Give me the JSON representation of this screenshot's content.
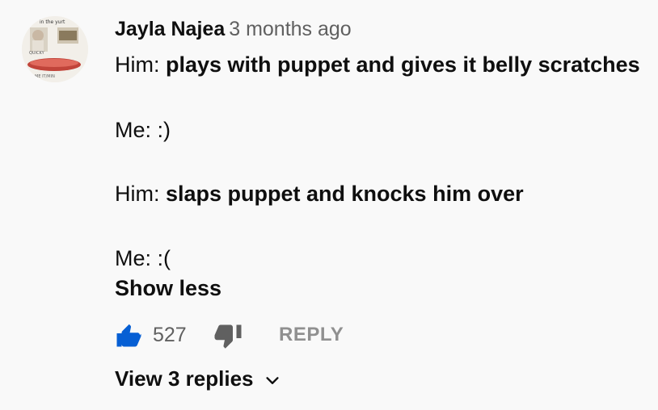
{
  "comment": {
    "author": "Jayla Najea",
    "timestamp": "3 months ago",
    "avatar": {
      "icon": "user-avatar-image",
      "top_text": "in the yurt",
      "sign_text": "QUICKY",
      "bottom_text": "ME IT/MIN"
    },
    "body": [
      {
        "prefix": "Him: ",
        "bold": "plays with puppet and gives it belly scratches"
      },
      {
        "prefix": "Me: :)",
        "bold": ""
      },
      {
        "prefix": "Him: ",
        "bold": "slaps puppet and knocks him over"
      },
      {
        "prefix": "Me: :(",
        "bold": ""
      }
    ],
    "show_less_label": "Show less",
    "like_count": "527",
    "reply_label": "REPLY",
    "view_replies_label": "View 3 replies"
  },
  "icons": {
    "like": "thumbs-up-icon",
    "dislike": "thumbs-down-icon",
    "expand": "chevron-down-icon"
  },
  "colors": {
    "like_active": "#065fd4",
    "secondary_text": "#606060",
    "reply_text": "#909090",
    "background": "#f9f9f9"
  }
}
